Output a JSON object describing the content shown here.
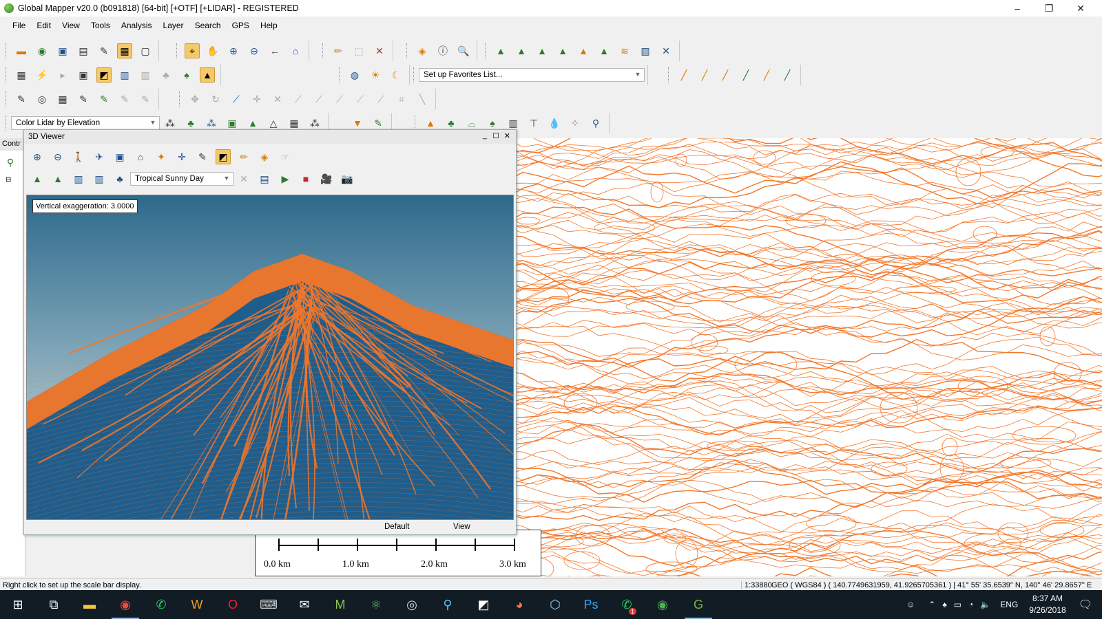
{
  "window": {
    "title": "Global Mapper v20.0 (b091818) [64-bit] [+OTF] [+LIDAR] - REGISTERED",
    "minimize": "‒",
    "restore": "❐",
    "close": "✕"
  },
  "menu": [
    "File",
    "Edit",
    "View",
    "Tools",
    "Analysis",
    "Layer",
    "Search",
    "GPS",
    "Help"
  ],
  "toolbars": {
    "favorites_placeholder": "Set up Favorites List...",
    "lidar_color_mode": "Color Lidar by Elevation"
  },
  "control_center": {
    "tab_label": "Contr"
  },
  "viewer3d": {
    "title": "3D Viewer",
    "sky_preset": "Tropical Sunny Day",
    "vertical_exaggeration": "Vertical exaggeration: 3.0000",
    "footer_left": "Default",
    "footer_right": "View"
  },
  "scalebar": {
    "labels": [
      "0.0 km",
      "1.0 km",
      "2.0 km",
      "3.0 km"
    ]
  },
  "statusbar": {
    "hint": "Right click to set up the scale bar display.",
    "scale": "1:33880",
    "coords": "GEO ( WGS84 ) ( 140.7749631959, 41.9265705361 ) | 41° 55' 35.6539\" N, 140° 46' 29.8657\" E"
  },
  "taskbar": {
    "icons": [
      "windows-start",
      "task-view",
      "file-explorer",
      "chrome",
      "whatsapp",
      "winamp",
      "opera",
      "keyboard",
      "mail",
      "money-manager",
      "atom",
      "obs",
      "global-search",
      "notes",
      "firefox",
      "box-3d",
      "photoshop",
      "whatsapp-notify",
      "hangouts",
      "global-mapper"
    ],
    "notification_badge": "1",
    "language": "ENG",
    "time": "8:37 AM",
    "date": "9/26/2018"
  },
  "colors": {
    "contour": "#f2772a",
    "terrain_blue": "#1f5d8c",
    "sky_top": "#2d6a8c",
    "sky_bottom": "#d7e4e6",
    "selected_tool": "#f5c86a",
    "taskbar": "#111c24"
  }
}
